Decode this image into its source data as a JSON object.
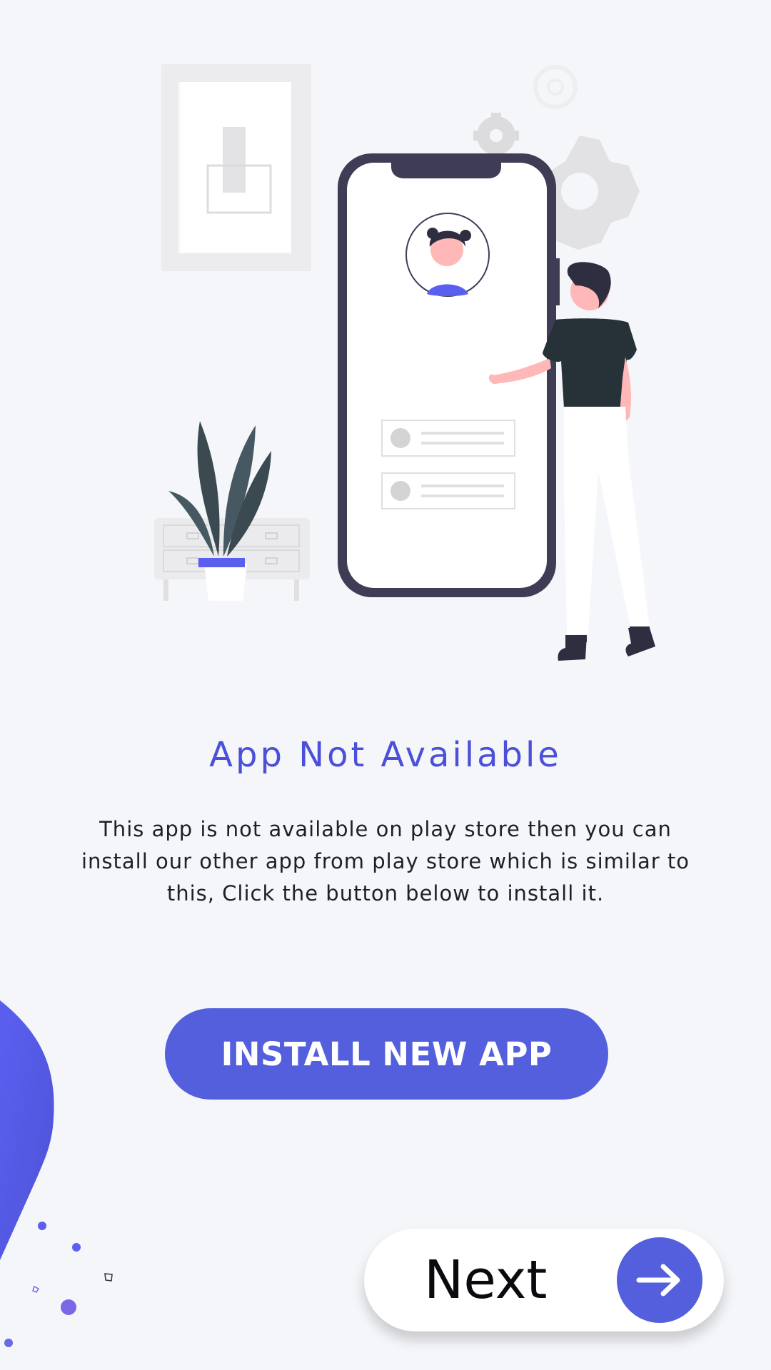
{
  "screen": {
    "title": "App Not Available",
    "description": "This app is not available on play store then you can install our other app from play store which is similar to this, Click the button below to install it.",
    "install_button_label": "INSTALL NEW APP",
    "next_button_label": "Next"
  },
  "colors": {
    "accent": "#535fdc",
    "title": "#4b4fd9",
    "background": "#f5f6fa",
    "text": "#1f1f24"
  },
  "icons": {
    "next": "arrow-right-icon"
  }
}
